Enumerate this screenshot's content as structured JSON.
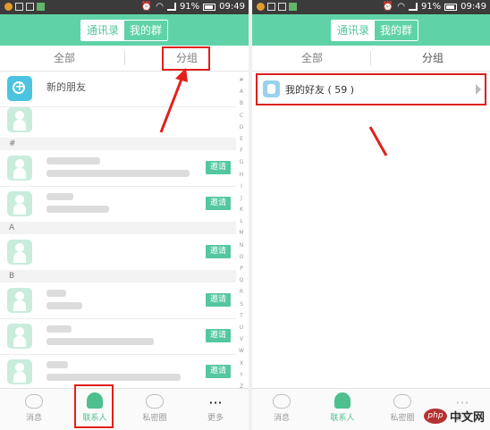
{
  "status": {
    "battery_pct": "91%",
    "time": "09:49"
  },
  "tabs": {
    "contacts": "通讯录",
    "groups": "我的群"
  },
  "subtabs": {
    "all": "全部",
    "grouping": "分组"
  },
  "left": {
    "new_friend": "新的朋友",
    "sections": [
      "#",
      "A",
      "B"
    ],
    "invite_label": "邀请",
    "index": [
      "#",
      "A",
      "B",
      "C",
      "D",
      "E",
      "F",
      "G",
      "H",
      "I",
      "J",
      "K",
      "L",
      "M",
      "N",
      "O",
      "P",
      "Q",
      "R",
      "S",
      "T",
      "U",
      "V",
      "W",
      "X",
      "Y",
      "Z"
    ]
  },
  "right": {
    "group_label": "我的好友 ( 59 )"
  },
  "bottom_tabs": [
    "消息",
    "联系人",
    "私密圈",
    "更多"
  ],
  "watermark": {
    "logo": "php",
    "text": "中文网"
  },
  "colors": {
    "accent": "#5fd3a7",
    "annotation_red": "#e3201a",
    "invite_green": "#55c7a0"
  }
}
